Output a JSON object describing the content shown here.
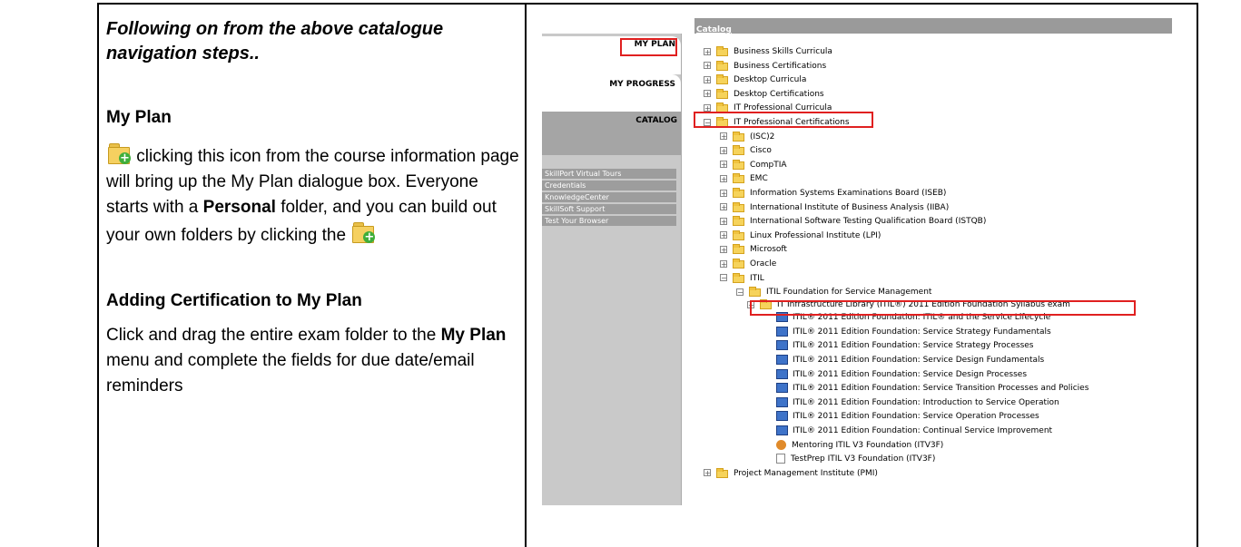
{
  "left": {
    "heading": "Following on from the above catalogue navigation steps..",
    "section1_title": "My Plan",
    "section1_text_a": " clicking this icon from the course information page will bring up the My Plan dialogue box.  Everyone starts with a ",
    "section1_bold": "Personal",
    "section1_text_b": " folder, and you can build out your own folders by clicking the ",
    "section2_title": "Adding Certification to My Plan",
    "section2_text_a": "Click and drag the entire exam folder to the ",
    "section2_bold": "My Plan",
    "section2_text_b": " menu and complete the fields for due date/email reminders",
    "icon_name": "add-to-plan-folder-icon"
  },
  "screenshot": {
    "topbar_link": "Catalog",
    "tabs": {
      "my_plan": "MY PLAN",
      "my_progress": "MY PROGRESS",
      "catalog": "CATALOG"
    },
    "sidebar_links": [
      "SkillPort Virtual Tours",
      "Credentials",
      "KnowledgeCenter",
      "SkillSoft Support",
      "Test Your Browser"
    ],
    "tree_top": [
      "Business Skills Curricula",
      "Business Certifications",
      "Desktop Curricula",
      "Desktop Certifications",
      "IT Professional Curricula",
      "IT Professional Certifications"
    ],
    "tree_vendors": [
      "(ISC)2",
      "Cisco",
      "CompTIA",
      "EMC",
      "Information Systems Examinations Board (ISEB)",
      "International Institute of Business Analysis (IIBA)",
      "International Software Testing Qualification Board (ISTQB)",
      "Linux Professional Institute (LPI)",
      "Microsoft",
      "Oracle",
      "ITIL"
    ],
    "itil_sub": "ITIL Foundation for Service Management",
    "itil_exam_folder": "IT Infrastructure Library (ITIL®) 2011 Edition Foundation Syllabus exam",
    "courses": [
      "ITIL® 2011 Edition Foundation: ITIL® and the Service Lifecycle",
      "ITIL® 2011 Edition Foundation: Service Strategy Fundamentals",
      "ITIL® 2011 Edition Foundation: Service Strategy Processes",
      "ITIL® 2011 Edition Foundation: Service Design Fundamentals",
      "ITIL® 2011 Edition Foundation: Service Design Processes",
      "ITIL® 2011 Edition Foundation: Service Transition Processes and Policies",
      "ITIL® 2011 Edition Foundation: Introduction to Service Operation",
      "ITIL® 2011 Edition Foundation: Service Operation Processes",
      "ITIL® 2011 Edition Foundation: Continual Service Improvement"
    ],
    "mentoring": "Mentoring ITIL V3 Foundation (ITV3F)",
    "testprep": "TestPrep ITIL V3 Foundation (ITV3F)",
    "last_folder": "Project Management Institute (PMI)"
  }
}
